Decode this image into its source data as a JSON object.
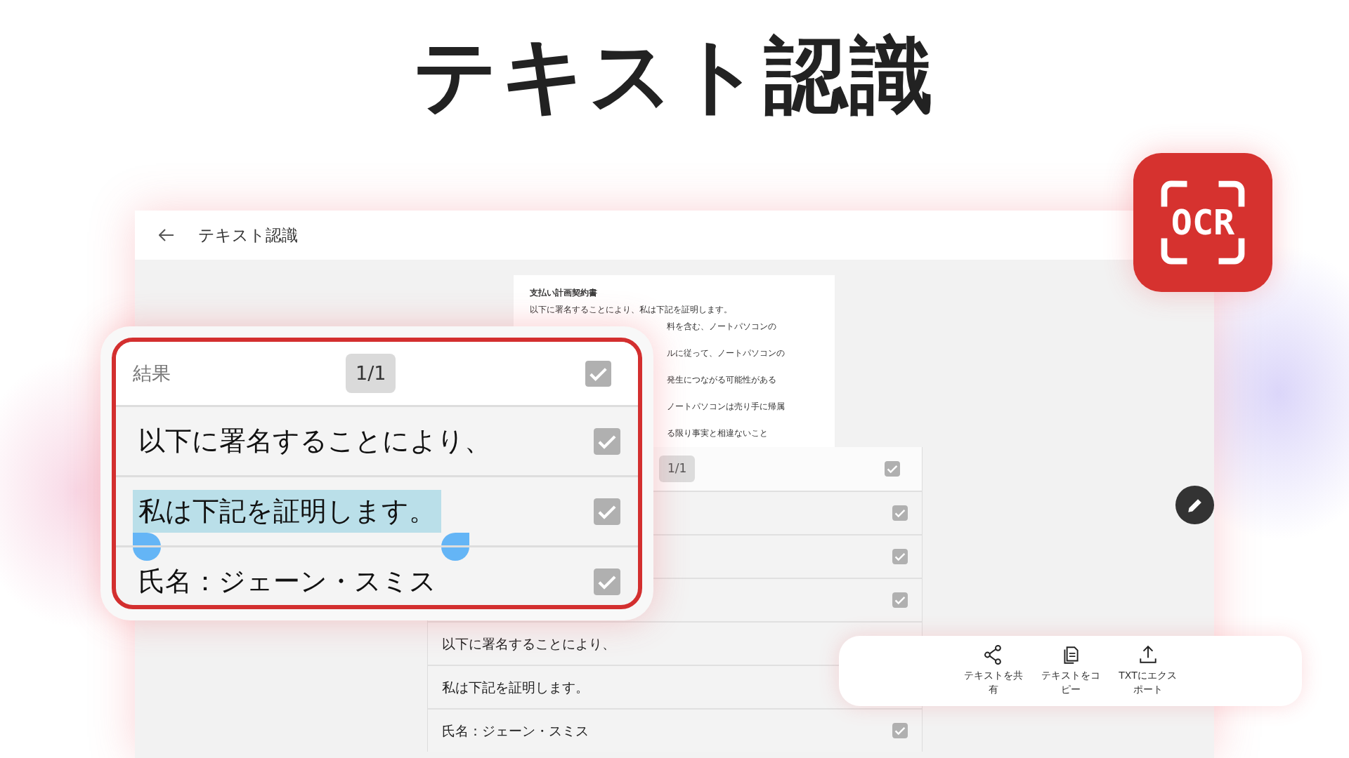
{
  "headline": "テキスト認識",
  "app": {
    "title": "テキスト認識"
  },
  "document": {
    "lines": [
      {
        "text": "支払い計画契約書",
        "kind": "heading"
      },
      {
        "text": "以下に署名することにより、私は下記を証明します。",
        "kind": "full"
      },
      {
        "text": "料を含む、ノートパソコンの",
        "kind": "cut"
      },
      {
        "text": "ルに従って、ノートパソコンの",
        "kind": "cut"
      },
      {
        "text": "発生につながる可能性がある",
        "kind": "cut"
      },
      {
        "text": "ノートパソコンは売り手に帰属",
        "kind": "cut"
      },
      {
        "text": "る限り事実と相違ないこと",
        "kind": "cut"
      }
    ]
  },
  "results_list": {
    "page": "1/1",
    "all_checked": true,
    "rows": [
      {
        "checked": true
      },
      {
        "checked": true
      },
      {
        "checked": true
      },
      {
        "text": "以下に署名することにより、"
      },
      {
        "text": "私は下記を証明します。"
      },
      {
        "text": "氏名：ジェーン・スミス",
        "checked": true
      }
    ]
  },
  "zoom_card": {
    "title": "結果",
    "page": "1/1",
    "all_checked": true,
    "rows": [
      {
        "text": "以下に署名することにより、",
        "checked": true,
        "selected": false
      },
      {
        "text": "私は下記を証明します。",
        "checked": true,
        "selected": true
      },
      {
        "text": "氏名：ジェーン・スミス",
        "checked": true,
        "selected": false
      }
    ]
  },
  "actions": [
    {
      "label": "テキストを共有",
      "kind": "share"
    },
    {
      "label": "テキストをコピー",
      "kind": "copy"
    },
    {
      "label": "TXTにエクスポート",
      "kind": "export"
    }
  ],
  "badge": {
    "label": "OCR"
  }
}
